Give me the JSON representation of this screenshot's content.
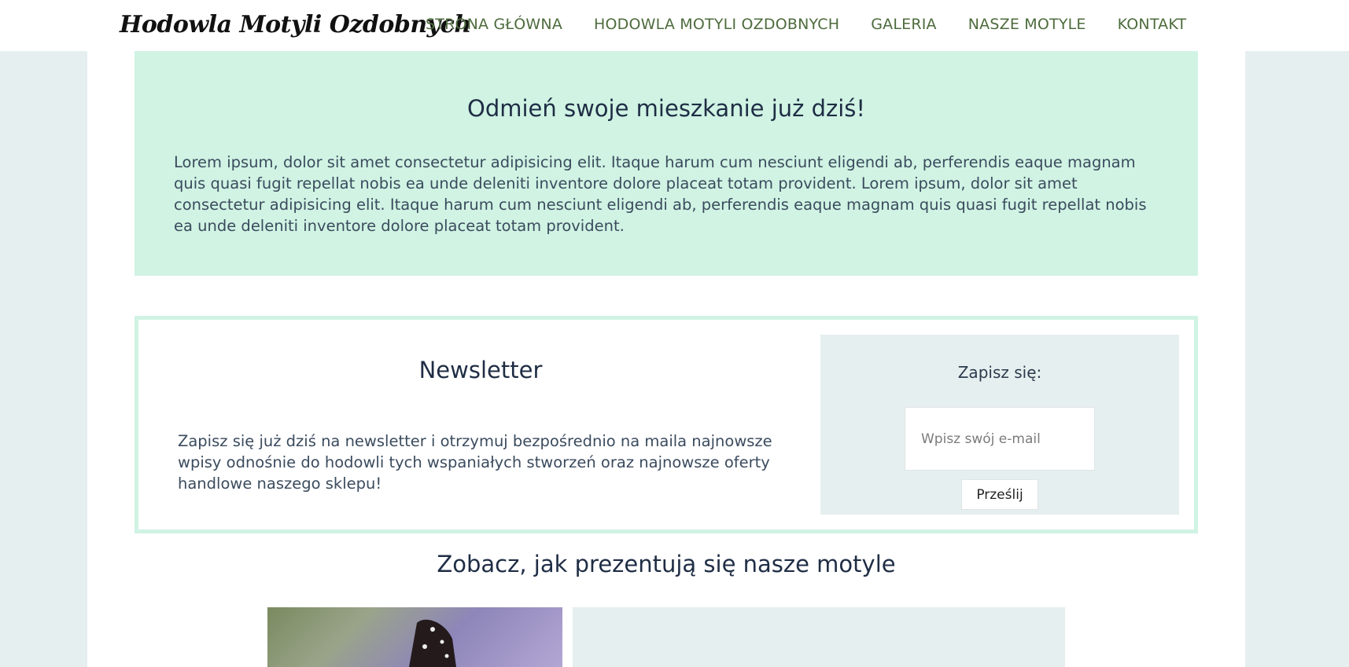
{
  "header": {
    "logo_text": "Hodowla Motyli Ozdobnych",
    "nav": [
      {
        "label": "STRONA GŁÓWNA"
      },
      {
        "label": "HODOWLA MOTYLI OZDOBNYCH"
      },
      {
        "label": "GALERIA"
      },
      {
        "label": "NASZE MOTYLE"
      },
      {
        "label": "KONTAKT"
      }
    ]
  },
  "promo": {
    "title": "Odmień swoje mieszkanie już dziś!",
    "text": "Lorem ipsum, dolor sit amet consectetur adipisicing elit. Itaque harum cum nesciunt eligendi ab, perferendis eaque magnam quis quasi fugit repellat nobis ea unde deleniti inventore dolore placeat totam provident. Lorem ipsum, dolor sit amet consectetur adipisicing elit. Itaque harum cum nesciunt eligendi ab, perferendis eaque magnam quis quasi fugit repellat nobis ea unde deleniti inventore dolore placeat totam provident."
  },
  "newsletter": {
    "title": "Newsletter",
    "text": "Zapisz się już dziś na newsletter i otrzymuj bezpośrednio na maila najnowsze wpisy odnośnie do hodowli tych wspaniałych stworzeń oraz najnowsze oferty handlowe naszego sklepu!",
    "signup_title": "Zapisz się:",
    "email_placeholder": "Wpisz swój e-mail",
    "email_value": "",
    "submit_label": "Prześlij"
  },
  "gallery": {
    "title": "Zobacz, jak prezentują się nasze motyle"
  },
  "colors": {
    "page_bg": "#e6efef",
    "promo_bg": "#d0f3e3",
    "nav_text": "#4d6b3c",
    "heading": "#1f2d45"
  }
}
